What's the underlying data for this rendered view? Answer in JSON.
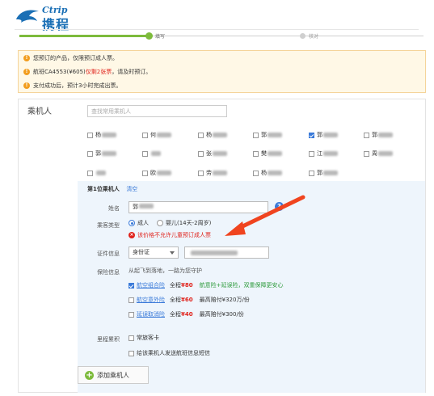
{
  "brand": {
    "logo_small": "Ctrip",
    "logo_main": "携程"
  },
  "progress": {
    "steps": [
      "填写",
      "核对"
    ],
    "current_step": 1
  },
  "notices": [
    {
      "parts": [
        "您预订的产品，仅限预订成人票。"
      ]
    },
    {
      "parts": [
        "航班CA4553(¥605)",
        "仅剩2张票",
        "，请及时预订。"
      ]
    },
    {
      "parts": [
        "支付成功后，预计3小时完成出票。"
      ]
    }
  ],
  "passenger": {
    "title": "乘机人",
    "search_placeholder": "查找常用乘机人",
    "contacts": [
      {
        "prefix": "杨",
        "checked": false
      },
      {
        "prefix": "何",
        "checked": false
      },
      {
        "prefix": "杨",
        "checked": false
      },
      {
        "prefix": "郭",
        "checked": false
      },
      {
        "prefix": "郭",
        "checked": true
      },
      {
        "prefix": "郭",
        "checked": false
      },
      {
        "prefix": "郭",
        "checked": false
      },
      {
        "prefix": "",
        "checked": false
      },
      {
        "prefix": "张",
        "checked": false
      },
      {
        "prefix": "樊",
        "checked": false
      },
      {
        "prefix": "江",
        "checked": false
      },
      {
        "prefix": "周",
        "checked": false
      },
      {
        "prefix": "",
        "checked": false
      },
      {
        "prefix": "欧",
        "checked": false
      },
      {
        "prefix": "劳",
        "checked": false
      },
      {
        "prefix": "杨",
        "checked": false
      },
      {
        "prefix": "郭",
        "checked": false
      }
    ]
  },
  "form": {
    "heading": "第1位乘机人",
    "clear_link": "清空",
    "name_label": "姓名",
    "name_value": "郭",
    "type_label": "乘客类型",
    "type_adult": "成人",
    "type_infant": "婴儿(14天-2周岁)",
    "type_error": "该价格不允许儿童预订成人票",
    "id_label": "证件信息",
    "id_type": "身份证",
    "insurance_label": "保险信息",
    "insurance_intro": "从起飞到落地，一路为您守护",
    "insurances": [
      {
        "name": "航空组合险",
        "checked": true,
        "price_label": "全程",
        "price": "¥80",
        "desc": "航意险+延误险，双重保障更安心",
        "desc_color": "#2e9b3c"
      },
      {
        "name": "航空意外险",
        "checked": false,
        "price_label": "全程",
        "price": "¥60",
        "desc": "最高赔付¥320万/份",
        "desc_color": "#333333"
      },
      {
        "name": "延误取消险",
        "checked": false,
        "price_label": "全程",
        "price": "¥40",
        "desc": "最高赔付¥300/份",
        "desc_color": "#333333"
      }
    ],
    "mileage_label": "里程累积",
    "frequent_flyer": "常旅客卡",
    "send_sms": "给该乘机人发送航班信息短信"
  },
  "add_passenger": "添加乘机人",
  "colors": {
    "accent": "#3a7ad9",
    "progress": "#7dbb3c",
    "warning": "#f29d1e",
    "error": "#e0231c"
  }
}
